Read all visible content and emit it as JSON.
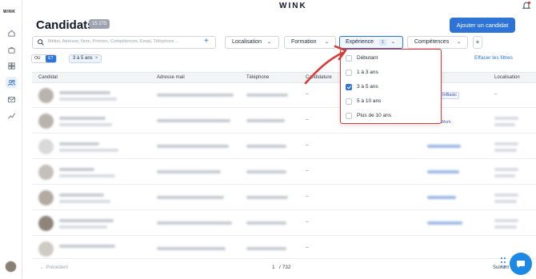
{
  "sidebar": {
    "logo": "WINK"
  },
  "header": {
    "brand": "WINK"
  },
  "page": {
    "title": "Candidats",
    "count": "15 275",
    "add_button": "Ajouter un candidat"
  },
  "search": {
    "placeholder": "Métier, Adresse, Nom, Prénom, Compétences, Email, Téléphone ..."
  },
  "filters": {
    "localisation": "Localisation",
    "formation": "Formation",
    "experience": "Expérience",
    "experience_count": "1",
    "competences": "Compétences",
    "more": "+"
  },
  "logic_toggle": {
    "ou": "OU",
    "et": "ET"
  },
  "active_chip": "3 à 5 ans",
  "clear_filters": "Effacer les filtres",
  "table": {
    "columns": [
      "Candidat",
      "Adresse mail",
      "Téléphone",
      "Candidature",
      "Localisation"
    ],
    "rows": [
      {
        "candidature": "–",
        "tag": "InBasic",
        "localisation": "–"
      },
      {
        "candidature": "–",
        "tag": "Work",
        "localisation": ""
      },
      {
        "candidature": "–",
        "tag": "",
        "localisation": ""
      },
      {
        "candidature": "–",
        "tag": "",
        "localisation": ""
      },
      {
        "candidature": "–",
        "tag": "",
        "localisation": ""
      },
      {
        "candidature": "–",
        "tag": "",
        "localisation": ""
      },
      {
        "candidature": "–",
        "tag": "",
        "localisation": ""
      }
    ]
  },
  "experience_dropdown": {
    "options": [
      {
        "label": "Débutant",
        "checked": false
      },
      {
        "label": "1 à 3 ans",
        "checked": false
      },
      {
        "label": "3 à 5 ans",
        "checked": true
      },
      {
        "label": "5 à 10 ans",
        "checked": false
      },
      {
        "label": "Plus de 10 ans",
        "checked": false
      }
    ]
  },
  "pagination": {
    "previous": "← Précédent",
    "page": "1",
    "total": "/ 732",
    "next": "Suivant"
  },
  "colors": {
    "accent": "#2d74d6",
    "highlight": "#d63b35"
  }
}
